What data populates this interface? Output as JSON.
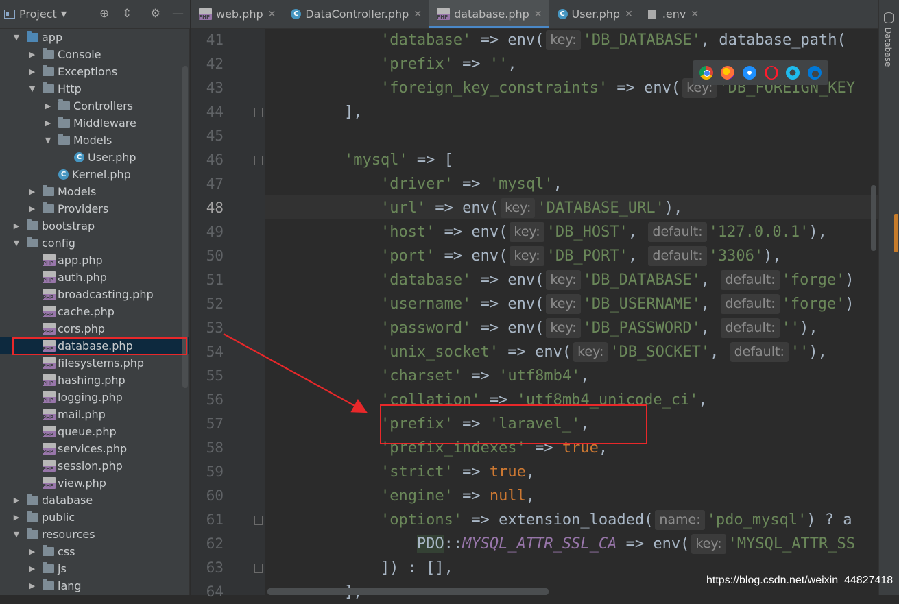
{
  "project_panel": {
    "title": "Project",
    "icons": [
      "target-icon",
      "collapse-icon",
      "gear-icon",
      "minimize-icon"
    ],
    "tree": [
      {
        "label": "app",
        "type": "folder-blue",
        "expanded": true,
        "depth": 0
      },
      {
        "label": "Console",
        "type": "folder",
        "expanded": false,
        "depth": 1
      },
      {
        "label": "Exceptions",
        "type": "folder",
        "expanded": false,
        "depth": 1
      },
      {
        "label": "Http",
        "type": "folder",
        "expanded": true,
        "depth": 1
      },
      {
        "label": "Controllers",
        "type": "folder",
        "expanded": false,
        "depth": 2
      },
      {
        "label": "Middleware",
        "type": "folder",
        "expanded": false,
        "depth": 2
      },
      {
        "label": "Models",
        "type": "folder",
        "expanded": true,
        "depth": 2
      },
      {
        "label": "User.php",
        "type": "class",
        "depth": 3
      },
      {
        "label": "Kernel.php",
        "type": "class",
        "depth": 2
      },
      {
        "label": "Models",
        "type": "folder",
        "expanded": false,
        "depth": 1
      },
      {
        "label": "Providers",
        "type": "folder",
        "expanded": false,
        "depth": 1
      },
      {
        "label": "bootstrap",
        "type": "folder",
        "expanded": false,
        "depth": 0
      },
      {
        "label": "config",
        "type": "folder",
        "expanded": true,
        "depth": 0
      },
      {
        "label": "app.php",
        "type": "php",
        "depth": 1
      },
      {
        "label": "auth.php",
        "type": "php",
        "depth": 1
      },
      {
        "label": "broadcasting.php",
        "type": "php",
        "depth": 1
      },
      {
        "label": "cache.php",
        "type": "php",
        "depth": 1
      },
      {
        "label": "cors.php",
        "type": "php",
        "depth": 1
      },
      {
        "label": "database.php",
        "type": "php",
        "depth": 1,
        "selected": true
      },
      {
        "label": "filesystems.php",
        "type": "php",
        "depth": 1
      },
      {
        "label": "hashing.php",
        "type": "php",
        "depth": 1
      },
      {
        "label": "logging.php",
        "type": "php",
        "depth": 1
      },
      {
        "label": "mail.php",
        "type": "php",
        "depth": 1
      },
      {
        "label": "queue.php",
        "type": "php",
        "depth": 1
      },
      {
        "label": "services.php",
        "type": "php",
        "depth": 1
      },
      {
        "label": "session.php",
        "type": "php",
        "depth": 1
      },
      {
        "label": "view.php",
        "type": "php",
        "depth": 1
      },
      {
        "label": "database",
        "type": "folder",
        "expanded": false,
        "depth": 0
      },
      {
        "label": "public",
        "type": "folder",
        "expanded": false,
        "depth": 0
      },
      {
        "label": "resources",
        "type": "folder",
        "expanded": true,
        "depth": 0
      },
      {
        "label": "css",
        "type": "folder",
        "expanded": false,
        "depth": 1
      },
      {
        "label": "js",
        "type": "folder",
        "expanded": false,
        "depth": 1
      },
      {
        "label": "lang",
        "type": "folder",
        "expanded": false,
        "depth": 1
      }
    ]
  },
  "tabs": [
    {
      "label": "web.php",
      "icon": "php-file-icon",
      "active": false
    },
    {
      "label": "DataController.php",
      "icon": "class-icon",
      "active": false
    },
    {
      "label": "database.php",
      "icon": "php-file-icon",
      "active": true
    },
    {
      "label": "User.php",
      "icon": "class-icon",
      "active": false
    },
    {
      "label": ".env",
      "icon": "text-file-icon",
      "active": false
    }
  ],
  "tab_close_glyph": "✕",
  "right_strip_label": "Database",
  "current_line": "48",
  "php_icon_text": "PHP",
  "class_icon_text": "C",
  "code_lines": [
    {
      "n": "41",
      "t": [
        [
          "p",
          "            "
        ],
        [
          "s",
          "'database'"
        ],
        [
          "p",
          " => env("
        ],
        [
          "h",
          "key:"
        ],
        [
          "s",
          "'DB_DATABASE'"
        ],
        [
          "p",
          ", database_path("
        ]
      ]
    },
    {
      "n": "42",
      "t": [
        [
          "p",
          "            "
        ],
        [
          "s",
          "'prefix'"
        ],
        [
          "p",
          " => "
        ],
        [
          "s",
          "''"
        ],
        [
          "p",
          ","
        ]
      ]
    },
    {
      "n": "43",
      "t": [
        [
          "p",
          "            "
        ],
        [
          "s",
          "'foreign_key_constraints'"
        ],
        [
          "p",
          " => env("
        ],
        [
          "h",
          "key:"
        ],
        [
          "s",
          "'DB_FOREIGN_KEY"
        ]
      ]
    },
    {
      "n": "44",
      "t": [
        [
          "p",
          "        ],"
        ]
      ],
      "fold": true
    },
    {
      "n": "45",
      "t": []
    },
    {
      "n": "46",
      "t": [
        [
          "p",
          "        "
        ],
        [
          "s",
          "'mysql'"
        ],
        [
          "p",
          " => ["
        ]
      ],
      "fold": true
    },
    {
      "n": "47",
      "t": [
        [
          "p",
          "            "
        ],
        [
          "s",
          "'driver'"
        ],
        [
          "p",
          " => "
        ],
        [
          "s",
          "'mysql'"
        ],
        [
          "p",
          ","
        ]
      ]
    },
    {
      "n": "48",
      "t": [
        [
          "p",
          "            "
        ],
        [
          "s",
          "'url'"
        ],
        [
          "p",
          " => env("
        ],
        [
          "h",
          "key:"
        ],
        [
          "s",
          "'DATABASE_URL'"
        ],
        [
          "p",
          "),"
        ]
      ]
    },
    {
      "n": "49",
      "t": [
        [
          "p",
          "            "
        ],
        [
          "s",
          "'host'"
        ],
        [
          "p",
          " => env("
        ],
        [
          "h",
          "key:"
        ],
        [
          "s",
          "'DB_HOST'"
        ],
        [
          "p",
          ", "
        ],
        [
          "h",
          "default:"
        ],
        [
          "s",
          "'127.0.0.1'"
        ],
        [
          "p",
          "),"
        ]
      ]
    },
    {
      "n": "50",
      "t": [
        [
          "p",
          "            "
        ],
        [
          "s",
          "'port'"
        ],
        [
          "p",
          " => env("
        ],
        [
          "h",
          "key:"
        ],
        [
          "s",
          "'DB_PORT'"
        ],
        [
          "p",
          ", "
        ],
        [
          "h",
          "default:"
        ],
        [
          "s",
          "'3306'"
        ],
        [
          "p",
          "),"
        ]
      ]
    },
    {
      "n": "51",
      "t": [
        [
          "p",
          "            "
        ],
        [
          "s",
          "'database'"
        ],
        [
          "p",
          " => env("
        ],
        [
          "h",
          "key:"
        ],
        [
          "s",
          "'DB_DATABASE'"
        ],
        [
          "p",
          ", "
        ],
        [
          "h",
          "default:"
        ],
        [
          "s",
          "'forge'"
        ],
        [
          "p",
          ")"
        ]
      ]
    },
    {
      "n": "52",
      "t": [
        [
          "p",
          "            "
        ],
        [
          "s",
          "'username'"
        ],
        [
          "p",
          " => env("
        ],
        [
          "h",
          "key:"
        ],
        [
          "s",
          "'DB_USERNAME'"
        ],
        [
          "p",
          ", "
        ],
        [
          "h",
          "default:"
        ],
        [
          "s",
          "'forge'"
        ],
        [
          "p",
          ")"
        ]
      ]
    },
    {
      "n": "53",
      "t": [
        [
          "p",
          "            "
        ],
        [
          "s",
          "'password'"
        ],
        [
          "p",
          " => env("
        ],
        [
          "h",
          "key:"
        ],
        [
          "s",
          "'DB_PASSWORD'"
        ],
        [
          "p",
          ", "
        ],
        [
          "h",
          "default:"
        ],
        [
          "s",
          "''"
        ],
        [
          "p",
          "),"
        ]
      ]
    },
    {
      "n": "54",
      "t": [
        [
          "p",
          "            "
        ],
        [
          "s",
          "'unix_socket'"
        ],
        [
          "p",
          " => env("
        ],
        [
          "h",
          "key:"
        ],
        [
          "s",
          "'DB_SOCKET'"
        ],
        [
          "p",
          ", "
        ],
        [
          "h",
          "default:"
        ],
        [
          "s",
          "''"
        ],
        [
          "p",
          "),"
        ]
      ]
    },
    {
      "n": "55",
      "t": [
        [
          "p",
          "            "
        ],
        [
          "s",
          "'charset'"
        ],
        [
          "p",
          " => "
        ],
        [
          "s",
          "'utf8mb4'"
        ],
        [
          "p",
          ","
        ]
      ]
    },
    {
      "n": "56",
      "t": [
        [
          "p",
          "            "
        ],
        [
          "s",
          "'collation'"
        ],
        [
          "p",
          " => "
        ],
        [
          "s",
          "'utf8mb4_unicode_ci'"
        ],
        [
          "p",
          ","
        ]
      ]
    },
    {
      "n": "57",
      "t": [
        [
          "p",
          "            "
        ],
        [
          "s",
          "'prefix'"
        ],
        [
          "p",
          " => "
        ],
        [
          "s",
          "'laravel_'"
        ],
        [
          "p",
          ","
        ]
      ]
    },
    {
      "n": "58",
      "t": [
        [
          "p",
          "            "
        ],
        [
          "s",
          "'prefix_indexes'"
        ],
        [
          "p",
          " => "
        ],
        [
          "k",
          "true"
        ],
        [
          "p",
          ","
        ]
      ]
    },
    {
      "n": "59",
      "t": [
        [
          "p",
          "            "
        ],
        [
          "s",
          "'strict'"
        ],
        [
          "p",
          " => "
        ],
        [
          "k",
          "true"
        ],
        [
          "p",
          ","
        ]
      ]
    },
    {
      "n": "60",
      "t": [
        [
          "p",
          "            "
        ],
        [
          "s",
          "'engine'"
        ],
        [
          "p",
          " => "
        ],
        [
          "k",
          "null"
        ],
        [
          "p",
          ","
        ]
      ]
    },
    {
      "n": "61",
      "t": [
        [
          "p",
          "            "
        ],
        [
          "s",
          "'options'"
        ],
        [
          "p",
          " => extension_loaded("
        ],
        [
          "h",
          "name:"
        ],
        [
          "s",
          "'pdo_mysql'"
        ],
        [
          "p",
          ") ? a"
        ]
      ],
      "fold": true
    },
    {
      "n": "62",
      "t": [
        [
          "p",
          "                "
        ],
        [
          "x",
          "PDO"
        ],
        [
          "p",
          "::"
        ],
        [
          "c",
          "MYSQL_ATTR_SSL_CA"
        ],
        [
          "p",
          " => env("
        ],
        [
          "h",
          "key:"
        ],
        [
          "s",
          "'MYSQL_ATTR_SS"
        ]
      ]
    },
    {
      "n": "63",
      "t": [
        [
          "p",
          "            ]) : [],"
        ]
      ],
      "fold": true
    },
    {
      "n": "64",
      "t": [
        [
          "p",
          "        ],"
        ]
      ]
    }
  ],
  "browser_icons": [
    "chrome-icon",
    "firefox-icon",
    "safari-icon",
    "opera-icon",
    "ie-icon",
    "edge-icon"
  ],
  "watermark": "https://blog.csdn.net/weixin_44827418",
  "colors": {
    "string": "#6a8759",
    "keyword": "#cc7832",
    "constant": "#9876aa",
    "annotation": "#e8282a"
  }
}
